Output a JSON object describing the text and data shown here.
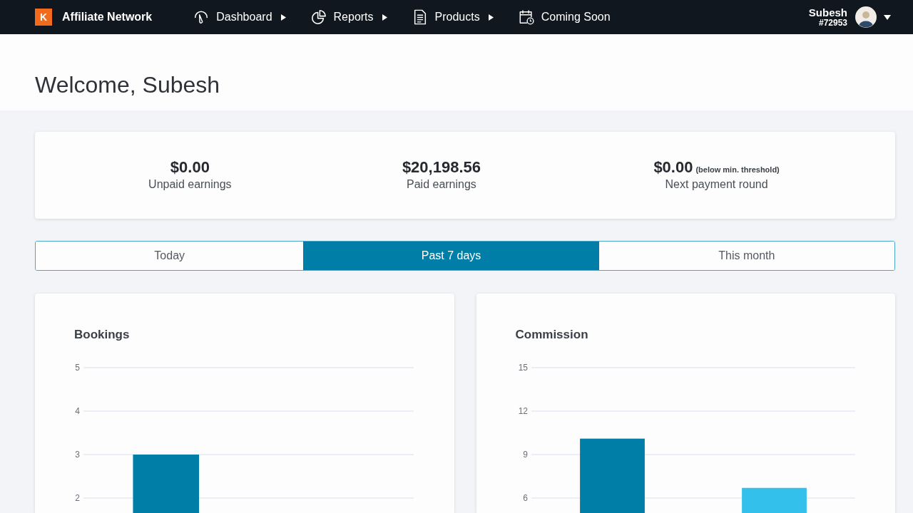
{
  "nav_bar": {
    "logo_letter": "K",
    "brand": "Affiliate Network",
    "items": [
      {
        "label": "Dashboard",
        "has_menu": true
      },
      {
        "label": "Reports",
        "has_menu": true
      },
      {
        "label": "Products",
        "has_menu": true
      },
      {
        "label": "Coming Soon",
        "has_menu": false
      }
    ],
    "user": {
      "name": "Subesh",
      "id": "#72953"
    }
  },
  "welcome": "Welcome, Subesh",
  "summary": [
    {
      "value": "$0.00",
      "label": "Unpaid earnings"
    },
    {
      "value": "$20,198.56",
      "label": "Paid earnings"
    },
    {
      "value": "$0.00",
      "note": "(below min. threshold)",
      "label": "Next payment round"
    }
  ],
  "tabs": [
    {
      "label": "Today",
      "selected": false
    },
    {
      "label": "Past 7 days",
      "selected": true
    },
    {
      "label": "This month",
      "selected": false
    }
  ],
  "charts": [
    {
      "chart_data": {
        "type": "bar",
        "title": "Bookings",
        "ylim": [
          1.656,
          5
        ],
        "yticks": [
          2,
          3,
          4,
          5
        ],
        "grid": true,
        "series": [
          {
            "color": "#007ea7",
            "values": [
              3,
              null
            ]
          }
        ]
      }
    },
    {
      "chart_data": {
        "type": "bar",
        "title": "Commission",
        "ylim": [
          4.967,
          15
        ],
        "yticks": [
          6,
          9,
          12,
          15
        ],
        "grid": true,
        "stacked": true,
        "series": [
          {
            "color": "#007ea7",
            "values": [
              10.1,
              null
            ]
          },
          {
            "color": "#33c0ea",
            "values": [
              null,
              6.7
            ]
          }
        ]
      }
    }
  ]
}
